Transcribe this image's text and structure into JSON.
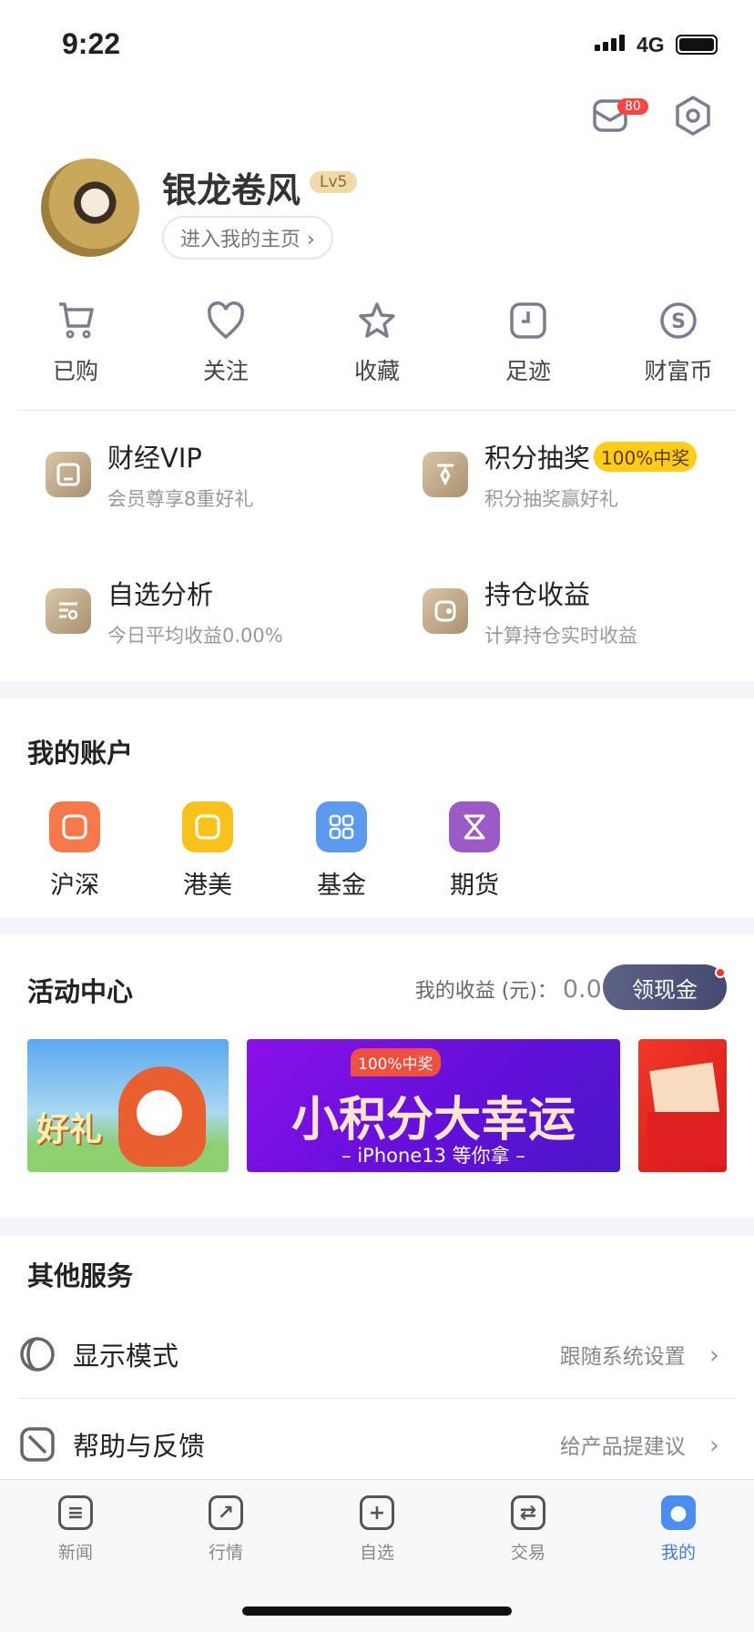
{
  "status_bar": {
    "time": "9:22",
    "network": "4G"
  },
  "header": {
    "message_count": "80",
    "icons": [
      "mail-icon",
      "settings-icon"
    ]
  },
  "profile": {
    "name": "银龙卷风",
    "level": "Lv5",
    "homepage_link": "进入我的主页 ›"
  },
  "shortcuts": [
    {
      "label": "已购",
      "icon": "cart-icon"
    },
    {
      "label": "关注",
      "icon": "heart-icon"
    },
    {
      "label": "收藏",
      "icon": "star-icon"
    },
    {
      "label": "足迹",
      "icon": "clock-icon"
    },
    {
      "label": "财富币",
      "icon": "coin-icon"
    }
  ],
  "features": [
    {
      "title": "财经VIP",
      "subtitle": "会员尊享8重好礼",
      "icon": "vip-icon"
    },
    {
      "title": "积分抽奖",
      "badge": "100%中奖",
      "subtitle": "积分抽奖赢好礼",
      "icon": "lottery-icon"
    },
    {
      "title": "自选分析",
      "subtitle": "今日平均收益0.00%",
      "icon": "analysis-icon"
    },
    {
      "title": "持仓收益",
      "subtitle": "计算持仓实时收益",
      "icon": "wallet-icon"
    }
  ],
  "accounts": {
    "title": "我的账户",
    "items": [
      {
        "label": "沪深",
        "color": "#f5794a"
      },
      {
        "label": "港美",
        "color": "#f7c21a"
      },
      {
        "label": "基金",
        "color": "#5a9bf0"
      },
      {
        "label": "期货",
        "color": "#9a5cc4"
      }
    ]
  },
  "activity": {
    "title": "活动中心",
    "earnings_label": "我的收益 (元)：",
    "earnings_value": "0.00",
    "cash_button": "领现金",
    "banners": [
      {
        "text": "好礼"
      },
      {
        "badge": "100%中奖",
        "title": "小积分大幸运",
        "subtitle": "– iPhone13 等你拿 –"
      },
      {
        "text": ""
      }
    ]
  },
  "services": {
    "title": "其他服务",
    "items": [
      {
        "label": "显示模式",
        "value": "跟随系统设置",
        "icon": "display-mode-icon"
      },
      {
        "label": "帮助与反馈",
        "value": "给产品提建议",
        "icon": "help-icon"
      }
    ]
  },
  "tabs": [
    {
      "label": "新闻",
      "icon": "news-icon"
    },
    {
      "label": "行情",
      "icon": "market-icon"
    },
    {
      "label": "自选",
      "icon": "add-watchlist-icon"
    },
    {
      "label": "交易",
      "icon": "trade-icon"
    },
    {
      "label": "我的",
      "icon": "profile-icon",
      "active": true
    }
  ]
}
